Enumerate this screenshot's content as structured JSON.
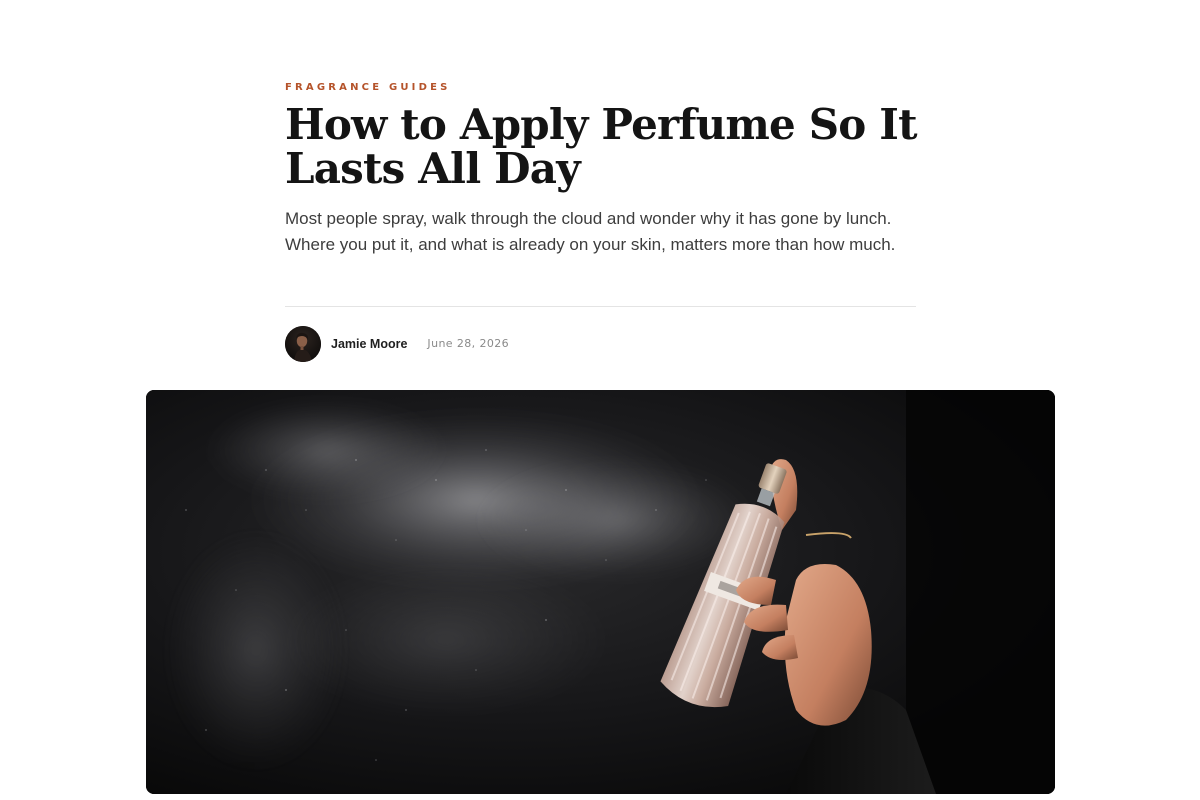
{
  "article": {
    "category": "FRAGRANCE GUIDES",
    "title": "How to Apply Perfume So It Lasts All Day",
    "dek": "Most people spray, walk through the cloud and wonder why it has gone by lunch. Where you put it, and what is already on your skin, matters more than how much.",
    "author": {
      "name": "Jamie Moore",
      "avatar_icon": "author-avatar-photo"
    },
    "published_date": "June 28, 2026"
  },
  "hero_image": {
    "subject": "hand-spraying-perfume-bottle-photo"
  },
  "colors": {
    "accent": "#b5532a",
    "title": "#141414",
    "body": "#3d3d3d",
    "muted": "#8a8a8a",
    "divider": "#e4e4e4",
    "hero_background": "#101010"
  }
}
